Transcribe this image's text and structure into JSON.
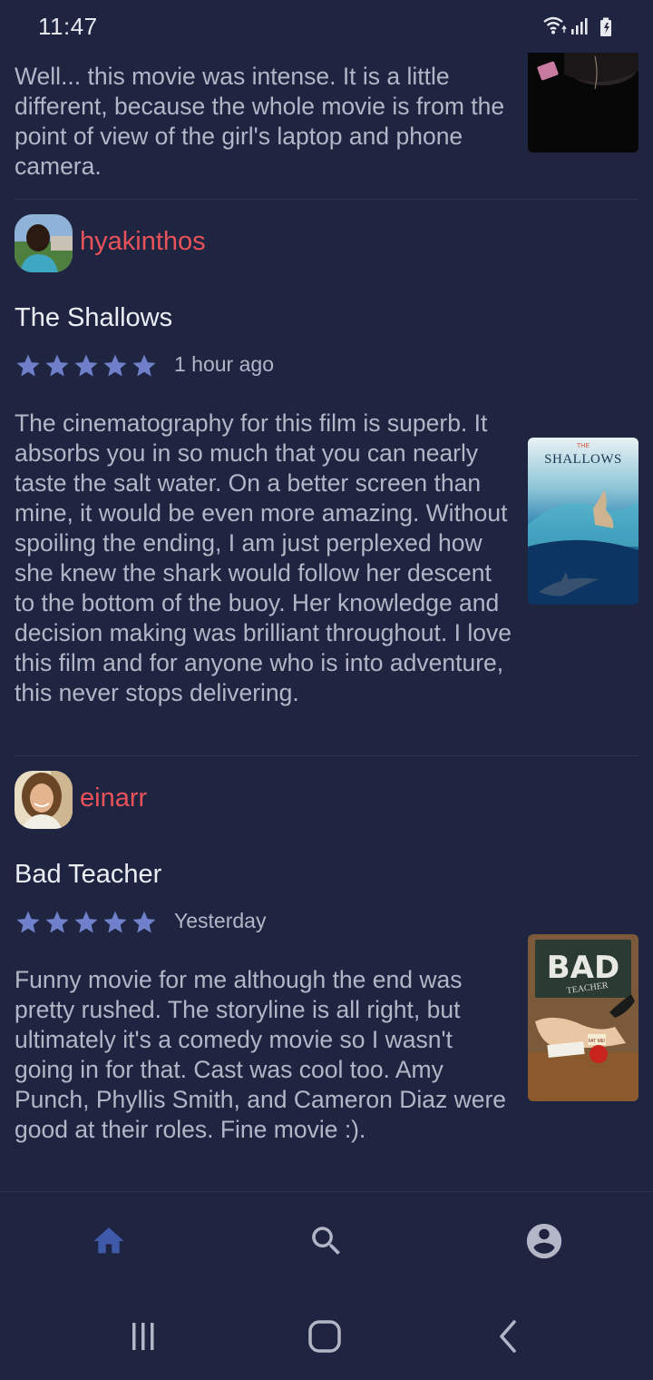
{
  "status": {
    "time": "11:47"
  },
  "top_review": {
    "text": "Well... this movie was intense. It is a little different, because the whole movie is from the point of view of the girl's laptop and phone camera."
  },
  "reviews": [
    {
      "user": "hyakinthos",
      "movie": "The Shallows",
      "rating": 5,
      "time": "1 hour ago",
      "text": "The cinematography for this film is superb. It absorbs you in so much that you can nearly taste the salt water. On a better screen than mine, it would be even more amazing. Without spoiling the ending, I am just perplexed how she knew the shark would follow her descent to the bottom of the buoy. Her knowledge and decision making was brilliant throughout. I love this film and for anyone who is into adventure, this never stops delivering.",
      "poster_title": "SHALLOWS",
      "poster_pretitle": "THE"
    },
    {
      "user": "einarr",
      "movie": "Bad Teacher",
      "rating": 5,
      "time": "Yesterday",
      "text": "Funny movie for me although the end was pretty rushed. The storyline is all right, but ultimately it's a comedy movie so I wasn't going in for that. Cast was cool too. Amy Punch, Phyllis Smith, and Cameron Diaz were good at their roles. Fine movie :).",
      "poster_title": "BAD",
      "poster_subtitle": "TEACHER",
      "poster_apple": "FAT ME!"
    }
  ],
  "nav": {
    "items": [
      {
        "icon": "home-icon",
        "active": true
      },
      {
        "icon": "search-icon",
        "active": false
      },
      {
        "icon": "account-icon",
        "active": false
      }
    ]
  },
  "system_nav": [
    "recent-apps-icon",
    "home-circle-icon",
    "back-icon"
  ],
  "colors": {
    "background": "#1f2541",
    "username": "#e8525a",
    "star": "#6f7fc9",
    "nav_active": "#3f5aa8",
    "nav_inactive": "#b3b6c6"
  }
}
